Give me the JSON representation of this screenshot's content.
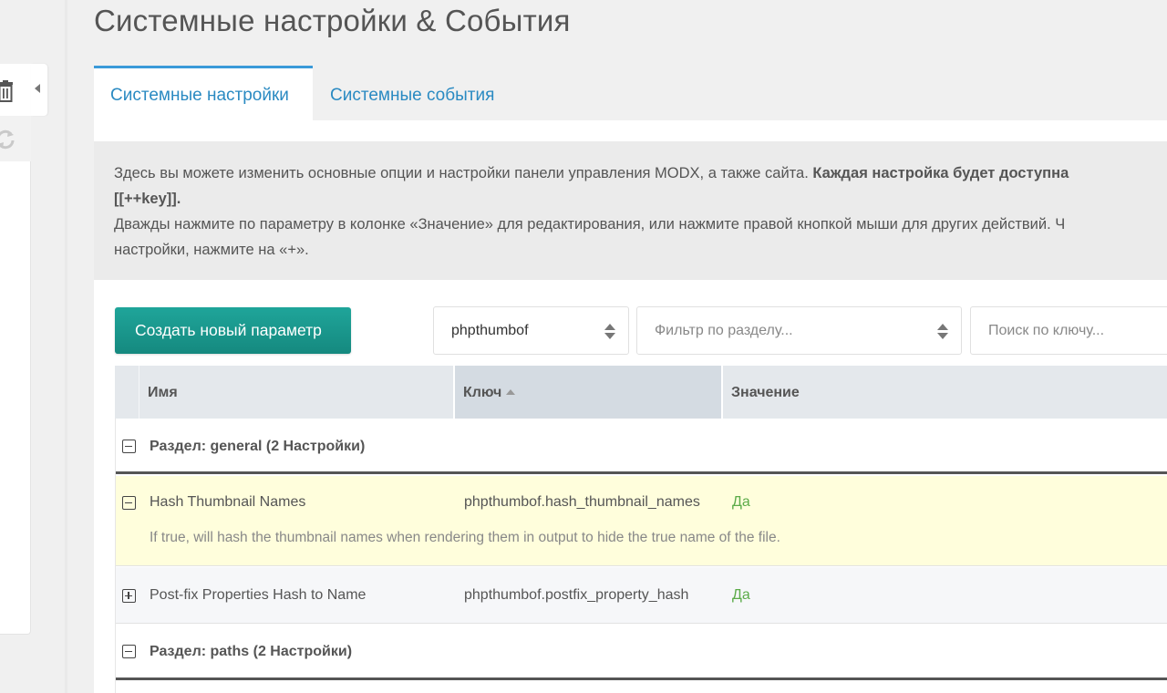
{
  "page": {
    "title": "Системные настройки & События"
  },
  "tabs": [
    {
      "label": "Системные настройки",
      "active": true
    },
    {
      "label": "Системные события",
      "active": false
    }
  ],
  "description": {
    "line1_plain": "Здесь вы можете изменить основные опции и настройки панели управления MODX, а также сайта. ",
    "line1_bold": "Каждая настройка будет доступна",
    "line2_bold": "[[++key]].",
    "line3": "Дважды нажмите по параметру в колонке «Значение» для редактирования, или нажмите правой кнопкой мыши для других действий. Ч",
    "line4": "настройки, нажмите на «+»."
  },
  "toolbar": {
    "create_label": "Создать новый параметр",
    "namespace_value": "phpthumbof",
    "area_placeholder": "Фильтр по разделу...",
    "search_placeholder": "Поиск по ключу..."
  },
  "grid": {
    "columns": {
      "name": "Имя",
      "key": "Ключ",
      "value": "Значение"
    },
    "groups": [
      {
        "label": "Раздел: general (2 Настройки)"
      },
      {
        "label": "Раздел: paths (2 Настройки)"
      }
    ],
    "rows": [
      {
        "name": "Hash Thumbnail Names",
        "key": "phpthumbof.hash_thumbnail_names",
        "value": "Да",
        "description": "If true, will hash the thumbnail names when rendering them in output to hide the true name of the file."
      },
      {
        "name": "Post-fix Properties Hash to Name",
        "key": "phpthumbof.postfix_property_hash",
        "value": "Да"
      }
    ]
  },
  "colors": {
    "accent": "#1fa59a",
    "link": "#2a8ac2",
    "value_yes": "#5cab49",
    "row_highlight": "#fffedc"
  }
}
